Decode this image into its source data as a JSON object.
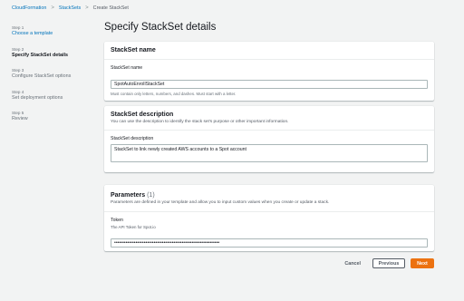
{
  "breadcrumb": {
    "items": [
      "CloudFormation",
      "StackSets",
      "Create StackSet"
    ],
    "separator": ">"
  },
  "steps": [
    {
      "num": "Step 1",
      "label": "Choose a template",
      "state": "link"
    },
    {
      "num": "Step 2",
      "label": "Specify StackSet details",
      "state": "active"
    },
    {
      "num": "Step 3",
      "label": "Configure StackSet options",
      "state": "inactive"
    },
    {
      "num": "Step 4",
      "label": "Set deployment options",
      "state": "inactive"
    },
    {
      "num": "Step 5",
      "label": "Review",
      "state": "inactive"
    }
  ],
  "page_title": "Specify StackSet details",
  "stackset_name": {
    "title": "StackSet name",
    "field_label": "StackSet name",
    "value": "SpotAutoEnrollStackSet",
    "constraint": "Must contain only letters, numbers, and dashes. Must start with a letter."
  },
  "stackset_description": {
    "title": "StackSet description",
    "desc": "You can use the description to identify the stack set's purpose or other important information.",
    "field_label": "StackSet description",
    "value": "StackSet to link newly created AWS accounts to a Spot account"
  },
  "parameters": {
    "title": "Parameters",
    "count": "(1)",
    "desc": "Parameters are defined in your template and allow you to input custom values when you create or update a stack.",
    "token_label": "Token",
    "token_sub": "The API Token for Spot.io",
    "token_value": "••••••••••••••••••••••••••••••••••••••••••••••••••••••••••••••••"
  },
  "actions": {
    "cancel": "Cancel",
    "previous": "Previous",
    "next": "Next"
  },
  "colors": {
    "link": "#0073bb",
    "primary": "#ec7211",
    "background": "#f2f3f3"
  }
}
